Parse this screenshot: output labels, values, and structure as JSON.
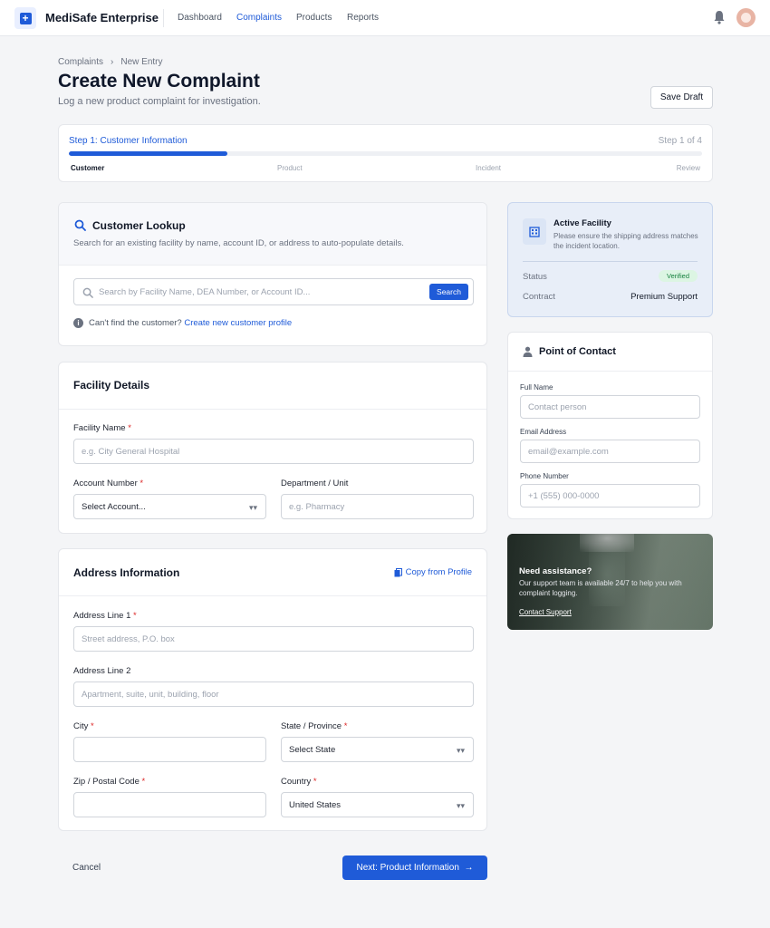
{
  "header": {
    "brand": "MediSafe Enterprise",
    "nav": [
      {
        "label": "Dashboard",
        "active": false
      },
      {
        "label": "Complaints",
        "active": true
      },
      {
        "label": "Products",
        "active": false
      },
      {
        "label": "Reports",
        "active": false
      }
    ],
    "icons": {
      "logo": "medical-cross-icon",
      "bell": "bell-icon"
    }
  },
  "breadcrumb": {
    "parent": "Complaints",
    "separator": "›",
    "current": "New Entry"
  },
  "page": {
    "title": "Create New Complaint",
    "subtitle": "Log a new product complaint for investigation.",
    "save_draft": "Save Draft"
  },
  "progress": {
    "label": "Step 1: Customer Information",
    "count": "Step 1 of 4",
    "fraction": 0.25,
    "steps": [
      "Customer",
      "Product",
      "Incident",
      "Review"
    ]
  },
  "lookup": {
    "title": "Customer Lookup",
    "description": "Search for an existing facility by name, account ID, or address to auto-populate details.",
    "search_placeholder": "Search by Facility Name, DEA Number, or Account ID...",
    "search_button": "Search",
    "help_text": "Can't find the customer?",
    "help_link": "Create new customer profile"
  },
  "facility": {
    "title": "Facility Details",
    "name_label": "Facility Name",
    "name_placeholder": "e.g. City General Hospital",
    "account_label": "Account Number",
    "account_value": "Select Account...",
    "department_label": "Department / Unit",
    "department_placeholder": "e.g. Pharmacy"
  },
  "address": {
    "title": "Address Information",
    "copy_link": "Copy from Profile",
    "line1_label": "Address Line 1",
    "line1_placeholder": "Street address, P.O. box",
    "line2_label": "Address Line 2",
    "line2_placeholder": "Apartment, suite, unit, building, floor",
    "city_label": "City",
    "state_label": "State / Province",
    "state_value": "Select State",
    "zip_label": "Zip / Postal Code",
    "country_label": "Country",
    "country_value": "United States"
  },
  "active_facility": {
    "title": "Active Facility",
    "description": "Please ensure the shipping address matches the incident location.",
    "status_label": "Status",
    "status_value": "Verified",
    "contract_label": "Contract",
    "contract_value": "Premium Support"
  },
  "contact": {
    "title": "Point of Contact",
    "name_label": "Full Name",
    "name_placeholder": "Contact person",
    "email_label": "Email Address",
    "email_placeholder": "email@example.com",
    "phone_label": "Phone Number",
    "phone_placeholder": "+1 (555) 000-0000"
  },
  "assistance": {
    "title": "Need assistance?",
    "text": "Our support team is available 24/7 to help you with complaint logging.",
    "link": "Contact Support"
  },
  "footer": {
    "cancel": "Cancel",
    "next": "Next: Product Information",
    "next_arrow": "→"
  },
  "colors": {
    "accent": "#1f5bd8",
    "required": "#dc2626",
    "verified": "#15803d"
  }
}
